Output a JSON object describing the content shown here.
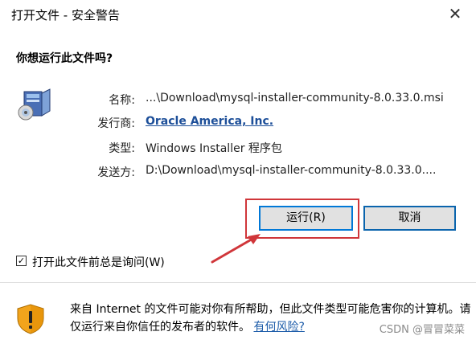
{
  "window": {
    "title": "打开文件 - 安全警告",
    "close_glyph": "✕"
  },
  "question": "你想运行此文件吗?",
  "details": [
    {
      "label": "名称:",
      "value": "...\\Download\\mysql-installer-community-8.0.33.0.msi",
      "is_link": false
    },
    {
      "label": "发行商:",
      "value": "Oracle America, Inc.",
      "is_link": true
    },
    {
      "label": "类型:",
      "value": "Windows Installer 程序包",
      "is_link": false
    },
    {
      "label": "发送方:",
      "value": "D:\\Download\\mysql-installer-community-8.0.33.0....",
      "is_link": false
    }
  ],
  "buttons": {
    "run": "运行(R)",
    "cancel": "取消"
  },
  "checkbox": {
    "label": "打开此文件前总是询问(W)",
    "checked": true,
    "check_glyph": "✓"
  },
  "warning": {
    "text": "来自 Internet 的文件可能对你有所帮助，但此文件类型可能危害你的计算机。请仅运行来自你信任的发布者的软件。",
    "link": "有何风险?"
  },
  "watermark": "CSDN @冒冒菜菜",
  "icons": {
    "package": "installer-package-icon",
    "shield": "security-shield-icon"
  },
  "colors": {
    "annotation_red": "#d0363a",
    "link_blue": "#1d4f99",
    "focus_blue": "#0078d7"
  }
}
